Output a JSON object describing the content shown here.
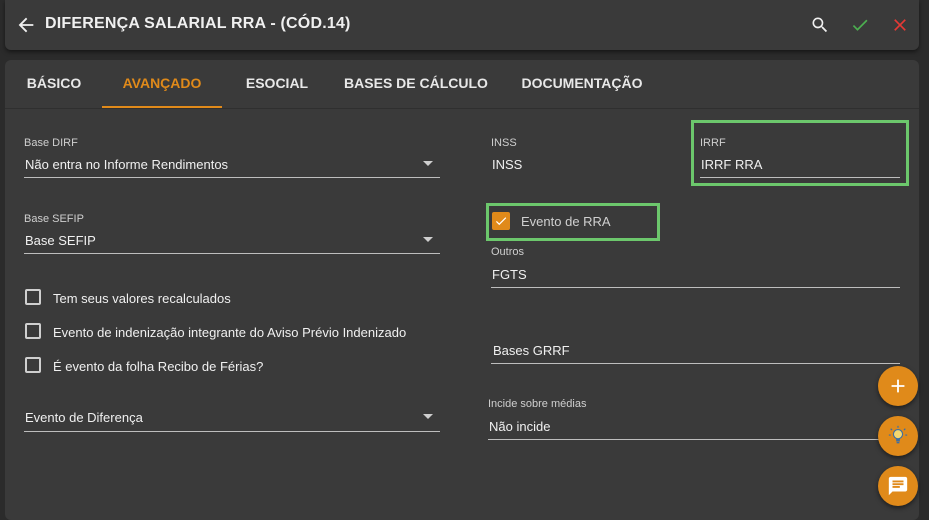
{
  "header": {
    "title": "DIFERENÇA SALARIAL RRA - (CÓD.14)"
  },
  "tabs": [
    {
      "label": "BÁSICO"
    },
    {
      "label": "AVANÇADO"
    },
    {
      "label": "ESOCIAL"
    },
    {
      "label": "BASES DE CÁLCULO"
    },
    {
      "label": "DOCUMENTAÇÃO"
    }
  ],
  "active_tab": "AVANÇADO",
  "form": {
    "base_dirf": {
      "label": "Base DIRF",
      "value": "Não entra no Informe Rendimentos"
    },
    "base_sefip": {
      "label": "Base SEFIP",
      "value": "Base SEFIP"
    },
    "checkboxes": [
      {
        "label": "Tem seus valores recalculados",
        "checked": false
      },
      {
        "label": "Evento de indenização integrante do Aviso Prévio Indenizado",
        "checked": false
      },
      {
        "label": "É evento da folha Recibo de Férias?",
        "checked": false
      }
    ],
    "evento_diferenca": {
      "value": "Evento de Diferença"
    },
    "inss": {
      "label": "INSS",
      "value": "INSS"
    },
    "irrf": {
      "label": "IRRF",
      "value": "IRRF RRA"
    },
    "evento_rra": {
      "label": "Evento de RRA",
      "checked": true
    },
    "outros": {
      "label": "Outros",
      "value": "FGTS"
    },
    "bases_grrf": {
      "value": "Bases GRRF"
    },
    "incide_medias": {
      "label": "Incide sobre médias",
      "value": "Não incide"
    }
  },
  "colors": {
    "accent": "#e08a1a",
    "highlight": "#6cc76c",
    "confirm": "#4caf50",
    "cancel": "#e53935"
  },
  "icons": [
    "arrow-left-icon",
    "search-icon",
    "check-icon",
    "close-icon",
    "plus-icon",
    "lightbulb-icon",
    "chat-icon"
  ]
}
